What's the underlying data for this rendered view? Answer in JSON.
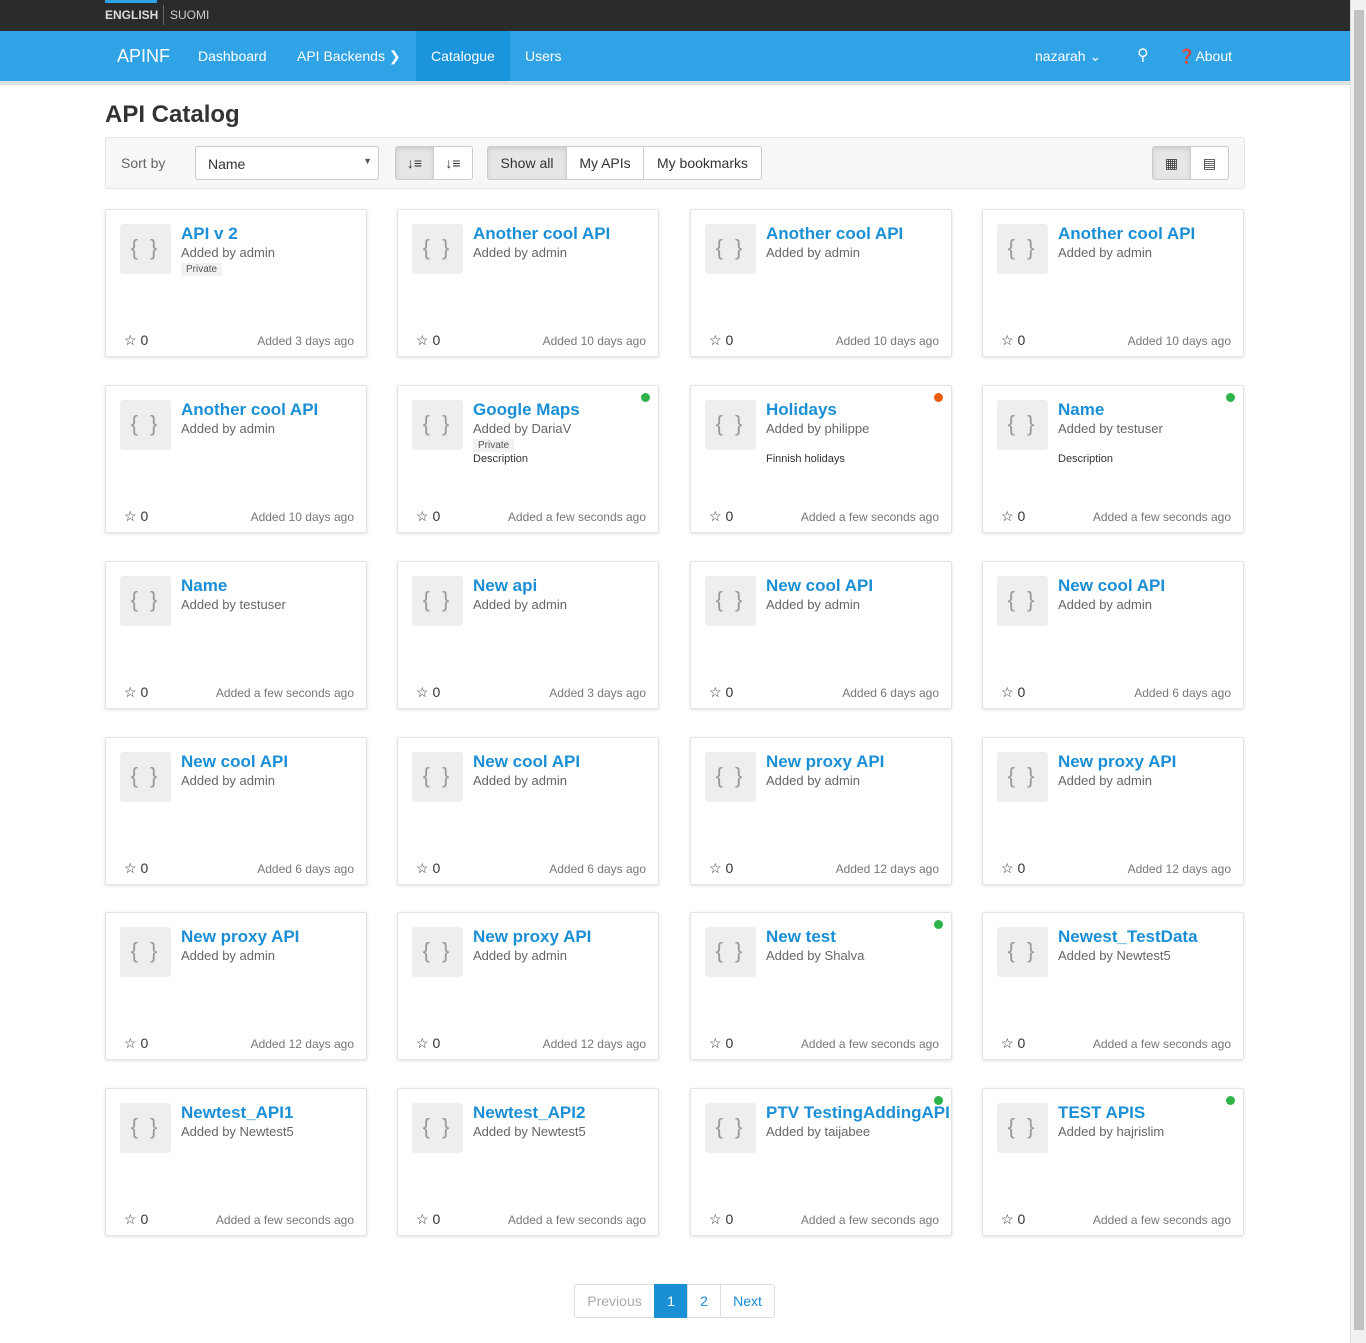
{
  "lang": {
    "english": "ENGLISH",
    "suomi": "SUOMI"
  },
  "nav": {
    "brand": "APINF",
    "dashboard": "Dashboard",
    "backends": "API Backends",
    "catalogue": "Catalogue",
    "users": "Users",
    "user": "nazarah",
    "about": "About"
  },
  "page": {
    "title": "API Catalog"
  },
  "toolbar": {
    "sort_label": "Sort by",
    "sort_value": "Name",
    "show_all": "Show all",
    "my_apis": "My APIs",
    "my_bookmarks": "My bookmarks"
  },
  "colors": {
    "accent": "#2fa3e6",
    "green": "#2db34a",
    "orange": "#ea5b0c"
  },
  "cards": [
    {
      "title": "API v 2",
      "by": "Added by admin",
      "private": "Private",
      "desc": "",
      "stars": "0",
      "date": "Added 3 days ago",
      "status": ""
    },
    {
      "title": "Another cool API",
      "by": "Added by admin",
      "private": "",
      "desc": "",
      "stars": "0",
      "date": "Added 10 days ago",
      "status": ""
    },
    {
      "title": "Another cool API",
      "by": "Added by admin",
      "private": "",
      "desc": "",
      "stars": "0",
      "date": "Added 10 days ago",
      "status": ""
    },
    {
      "title": "Another cool API",
      "by": "Added by admin",
      "private": "",
      "desc": "",
      "stars": "0",
      "date": "Added 10 days ago",
      "status": ""
    },
    {
      "title": "Another cool API",
      "by": "Added by admin",
      "private": "",
      "desc": "",
      "stars": "0",
      "date": "Added 10 days ago",
      "status": ""
    },
    {
      "title": "Google Maps",
      "by": "Added by DariaV",
      "private": "Private",
      "desc": "Description",
      "stars": "0",
      "date": "Added a few seconds ago",
      "status": "green"
    },
    {
      "title": "Holidays",
      "by": "Added by philippe",
      "private": "",
      "desc": "Finnish holidays",
      "stars": "0",
      "date": "Added a few seconds ago",
      "status": "orange"
    },
    {
      "title": "Name",
      "by": "Added by testuser",
      "private": "",
      "desc": "Description",
      "stars": "0",
      "date": "Added a few seconds ago",
      "status": "green"
    },
    {
      "title": "Name",
      "by": "Added by testuser",
      "private": "",
      "desc": "",
      "stars": "0",
      "date": "Added a few seconds ago",
      "status": ""
    },
    {
      "title": "New api",
      "by": "Added by admin",
      "private": "",
      "desc": "",
      "stars": "0",
      "date": "Added 3 days ago",
      "status": ""
    },
    {
      "title": "New cool API",
      "by": "Added by admin",
      "private": "",
      "desc": "",
      "stars": "0",
      "date": "Added 6 days ago",
      "status": ""
    },
    {
      "title": "New cool API",
      "by": "Added by admin",
      "private": "",
      "desc": "",
      "stars": "0",
      "date": "Added 6 days ago",
      "status": ""
    },
    {
      "title": "New cool API",
      "by": "Added by admin",
      "private": "",
      "desc": "",
      "stars": "0",
      "date": "Added 6 days ago",
      "status": ""
    },
    {
      "title": "New cool API",
      "by": "Added by admin",
      "private": "",
      "desc": "",
      "stars": "0",
      "date": "Added 6 days ago",
      "status": ""
    },
    {
      "title": "New proxy API",
      "by": "Added by admin",
      "private": "",
      "desc": "",
      "stars": "0",
      "date": "Added 12 days ago",
      "status": ""
    },
    {
      "title": "New proxy API",
      "by": "Added by admin",
      "private": "",
      "desc": "",
      "stars": "0",
      "date": "Added 12 days ago",
      "status": ""
    },
    {
      "title": "New proxy API",
      "by": "Added by admin",
      "private": "",
      "desc": "",
      "stars": "0",
      "date": "Added 12 days ago",
      "status": ""
    },
    {
      "title": "New proxy API",
      "by": "Added by admin",
      "private": "",
      "desc": "",
      "stars": "0",
      "date": "Added 12 days ago",
      "status": ""
    },
    {
      "title": "New test",
      "by": "Added by Shalva",
      "private": "",
      "desc": "",
      "stars": "0",
      "date": "Added a few seconds ago",
      "status": "green"
    },
    {
      "title": "Newest_TestData",
      "by": "Added by Newtest5",
      "private": "",
      "desc": "",
      "stars": "0",
      "date": "Added a few seconds ago",
      "status": ""
    },
    {
      "title": "Newtest_API1",
      "by": "Added by Newtest5",
      "private": "",
      "desc": "",
      "stars": "0",
      "date": "Added a few seconds ago",
      "status": ""
    },
    {
      "title": "Newtest_API2",
      "by": "Added by Newtest5",
      "private": "",
      "desc": "",
      "stars": "0",
      "date": "Added a few seconds ago",
      "status": ""
    },
    {
      "title": "PTV TestingAddingAPI",
      "by": "Added by taijabee",
      "private": "",
      "desc": "",
      "stars": "0",
      "date": "Added a few seconds ago",
      "status": "green"
    },
    {
      "title": "TEST APIS",
      "by": "Added by hajrislim",
      "private": "",
      "desc": "",
      "stars": "0",
      "date": "Added a few seconds ago",
      "status": "green"
    }
  ],
  "pagination": {
    "previous": "Previous",
    "pages": [
      "1",
      "2"
    ],
    "current": "1",
    "next": "Next"
  }
}
